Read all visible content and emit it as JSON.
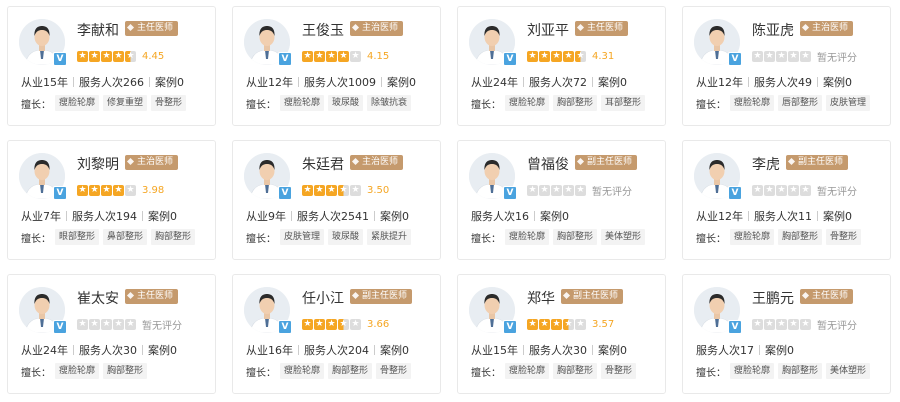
{
  "doctors": [
    {
      "name": "李献和",
      "title": "主任医师",
      "stars": 4.5,
      "score": "4.45",
      "stats": [
        "从业15年",
        "服务人次266",
        "案例0"
      ],
      "spec_label": "擅长：",
      "specialties": [
        "瘦脸轮廓",
        "修复重塑",
        "骨整形"
      ]
    },
    {
      "name": "王俊玉",
      "title": "主治医师",
      "stars": 4,
      "score": "4.15",
      "stats": [
        "从业12年",
        "服务人次1009",
        "案例0"
      ],
      "spec_label": "擅长：",
      "specialties": [
        "瘦脸轮廓",
        "玻尿酸",
        "除皱抗衰"
      ]
    },
    {
      "name": "刘亚平",
      "title": "主任医师",
      "stars": 4.5,
      "score": "4.31",
      "stats": [
        "从业24年",
        "服务人次72",
        "案例0"
      ],
      "spec_label": "擅长：",
      "specialties": [
        "瘦脸轮廓",
        "胸部整形",
        "耳部整形"
      ]
    },
    {
      "name": "陈亚虎",
      "title": "主治医师",
      "stars": 0,
      "score": "暂无评分",
      "stats": [
        "从业12年",
        "服务人次49",
        "案例0"
      ],
      "spec_label": "擅长：",
      "specialties": [
        "瘦脸轮廓",
        "唇部整形",
        "皮肤管理"
      ]
    },
    {
      "name": "刘黎明",
      "title": "主治医师",
      "stars": 4,
      "score": "3.98",
      "stats": [
        "从业7年",
        "服务人次194",
        "案例0"
      ],
      "spec_label": "擅长：",
      "specialties": [
        "眼部整形",
        "鼻部整形",
        "胸部整形"
      ]
    },
    {
      "name": "朱廷君",
      "title": "主治医师",
      "stars": 3.5,
      "score": "3.50",
      "stats": [
        "从业9年",
        "服务人次2541",
        "案例0"
      ],
      "spec_label": "擅长：",
      "specialties": [
        "皮肤管理",
        "玻尿酸",
        "紧肤提升"
      ]
    },
    {
      "name": "曾福俊",
      "title": "副主任医师",
      "stars": 0,
      "score": "暂无评分",
      "stats": [
        "服务人次16",
        "案例0"
      ],
      "spec_label": "擅长：",
      "specialties": [
        "瘦脸轮廓",
        "胸部整形",
        "美体塑形"
      ]
    },
    {
      "name": "李虎",
      "title": "副主任医师",
      "stars": 0,
      "score": "暂无评分",
      "stats": [
        "从业12年",
        "服务人次11",
        "案例0"
      ],
      "spec_label": "擅长：",
      "specialties": [
        "瘦脸轮廓",
        "胸部整形",
        "骨整形"
      ]
    },
    {
      "name": "崔太安",
      "title": "主任医师",
      "stars": 0,
      "score": "暂无评分",
      "stats": [
        "从业24年",
        "服务人次30",
        "案例0"
      ],
      "spec_label": "擅长：",
      "specialties": [
        "瘦脸轮廓",
        "胸部整形"
      ]
    },
    {
      "name": "任小江",
      "title": "副主任医师",
      "stars": 3.5,
      "score": "3.66",
      "stats": [
        "从业16年",
        "服务人次204",
        "案例0"
      ],
      "spec_label": "擅长：",
      "specialties": [
        "瘦脸轮廓",
        "胸部整形",
        "骨整形"
      ]
    },
    {
      "name": "郑华",
      "title": "副主任医师",
      "stars": 3.5,
      "score": "3.57",
      "stats": [
        "从业15年",
        "服务人次30",
        "案例0"
      ],
      "spec_label": "擅长：",
      "specialties": [
        "瘦脸轮廓",
        "胸部整形",
        "骨整形"
      ]
    },
    {
      "name": "王鹏元",
      "title": "主任医师",
      "stars": 0,
      "score": "暂无评分",
      "stats": [
        "服务人次17",
        "案例0"
      ],
      "spec_label": "擅长：",
      "specialties": [
        "瘦脸轮廓",
        "胸部整形",
        "美体塑形"
      ]
    }
  ],
  "colors": {
    "badge": "#c59a6d",
    "star": "#f5a623",
    "verified": "#4aa3df"
  },
  "verified_mark": "V"
}
